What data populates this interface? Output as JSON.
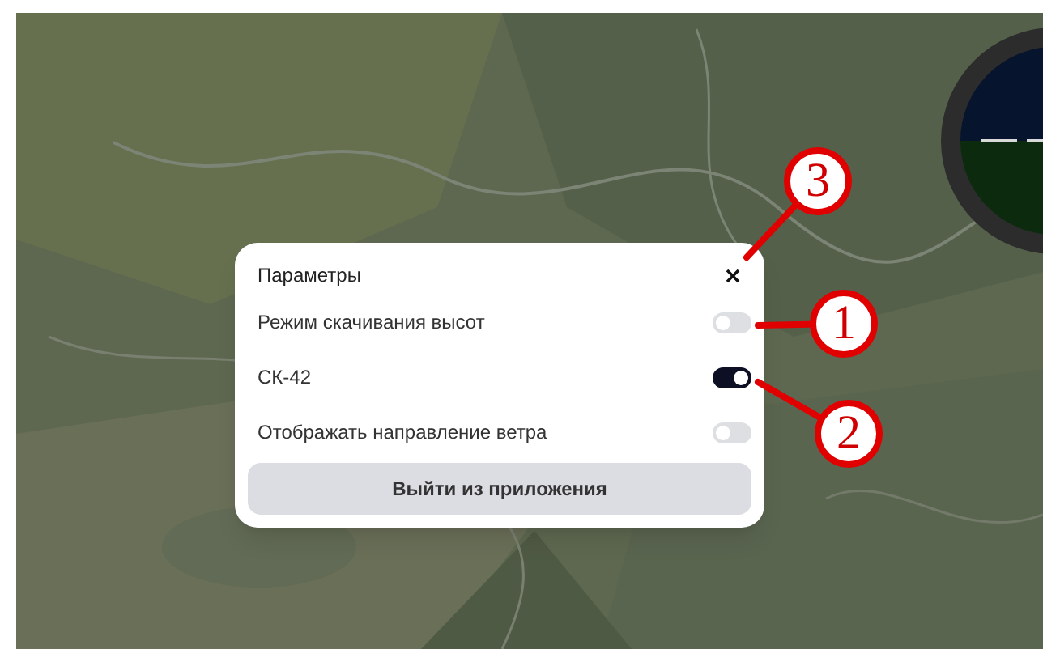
{
  "dialog": {
    "title": "Параметры",
    "settings": [
      {
        "label": "Режим скачивания высот",
        "on": false
      },
      {
        "label": "СК-42",
        "on": true
      },
      {
        "label": "Отображать направление ветра",
        "on": false
      }
    ],
    "exit_button": "Выйти из приложения"
  },
  "callouts": [
    {
      "label": "3"
    },
    {
      "label": "1"
    },
    {
      "label": "2"
    }
  ]
}
